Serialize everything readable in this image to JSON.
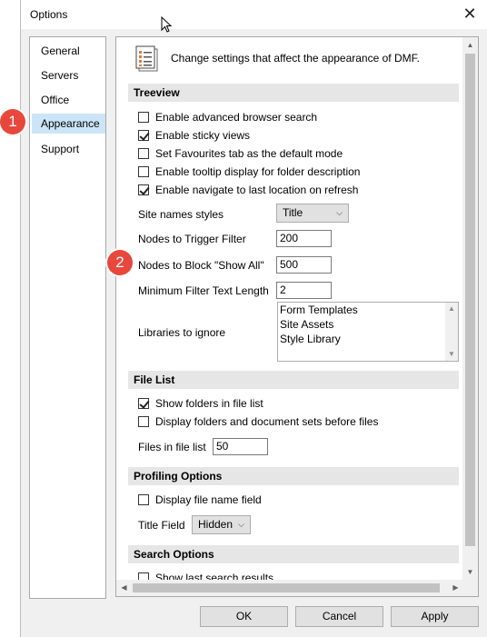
{
  "window": {
    "title": "Options"
  },
  "nav": {
    "items": [
      {
        "label": "General"
      },
      {
        "label": "Servers"
      },
      {
        "label": "Office"
      },
      {
        "label": "Appearance",
        "selected": true
      },
      {
        "label": "Support"
      }
    ]
  },
  "header": {
    "text": "Change settings that affect the appearance of DMF."
  },
  "treeview": {
    "heading": "Treeview",
    "options": [
      {
        "label": "Enable advanced browser search",
        "checked": false
      },
      {
        "label": "Enable sticky views",
        "checked": true
      },
      {
        "label": "Set Favourites tab as the default mode",
        "checked": false
      },
      {
        "label": "Enable tooltip display for folder description",
        "checked": false
      },
      {
        "label": "Enable navigate to last location on refresh",
        "checked": true
      }
    ],
    "site_names_styles": {
      "label": "Site names styles",
      "value": "Title"
    },
    "nodes_trigger_filter": {
      "label": "Nodes to Trigger Filter",
      "value": "200"
    },
    "nodes_block_show_all": {
      "label": "Nodes to Block \"Show All\"",
      "value": "500"
    },
    "min_filter_text_length": {
      "label": "Minimum Filter Text Length",
      "value": "2"
    },
    "libraries_to_ignore": {
      "label": "Libraries to ignore",
      "items": [
        "Form Templates",
        "Site Assets",
        "Style Library"
      ]
    }
  },
  "file_list": {
    "heading": "File List",
    "options": [
      {
        "label": "Show folders in file list",
        "checked": true
      },
      {
        "label": "Display folders and document sets before files",
        "checked": false
      }
    ],
    "files_in_list": {
      "label": "Files in file list",
      "value": "50"
    }
  },
  "profiling": {
    "heading": "Profiling Options",
    "options": [
      {
        "label": "Display file name field",
        "checked": false
      }
    ],
    "title_field": {
      "label": "Title Field",
      "value": "Hidden"
    }
  },
  "search": {
    "heading": "Search Options",
    "options": [
      {
        "label": "Show last search results",
        "checked": false
      }
    ]
  },
  "buttons": {
    "ok": "OK",
    "cancel": "Cancel",
    "apply": "Apply"
  },
  "badges": {
    "one": "1",
    "two": "2"
  },
  "colors": {
    "selection": "#cce4f7",
    "badge": "#e8473c",
    "section": "#e6e6e6"
  }
}
